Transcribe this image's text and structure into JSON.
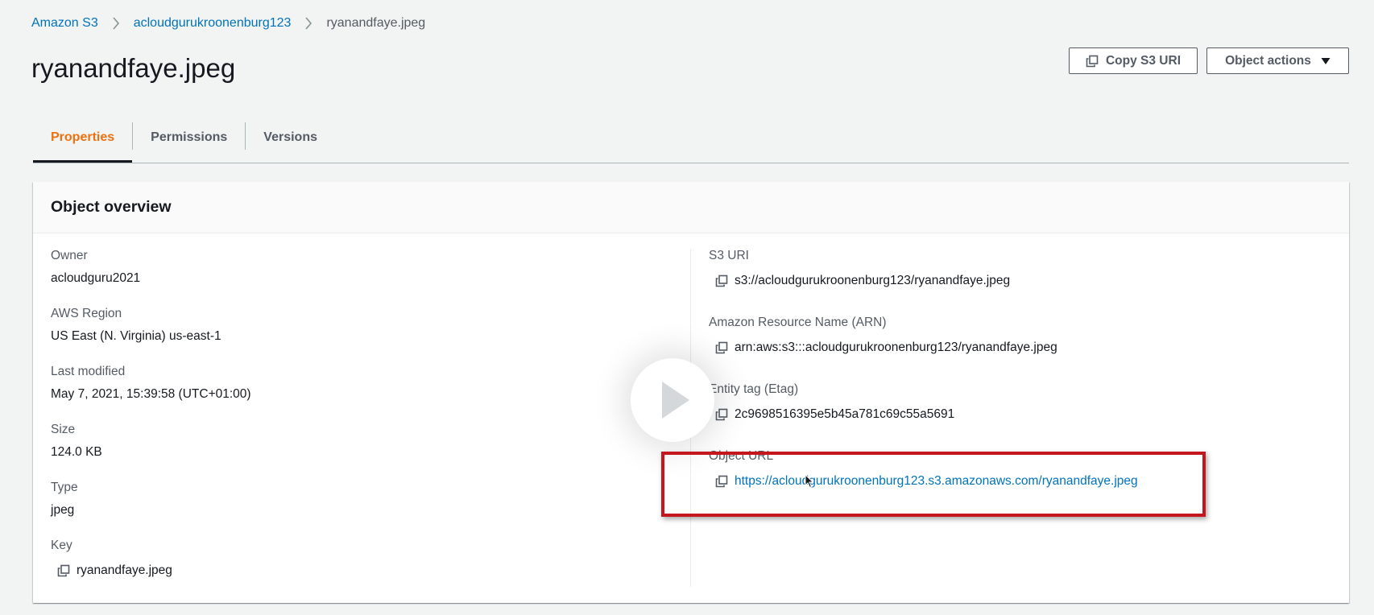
{
  "breadcrumb": {
    "items": [
      "Amazon S3",
      "acloudgurukroonenburg123"
    ],
    "current": "ryanandfaye.jpeg"
  },
  "page": {
    "title": "ryanandfaye.jpeg"
  },
  "header_actions": {
    "copy_uri": "Copy S3 URI",
    "object_actions": "Object actions"
  },
  "tabs": [
    {
      "label": "Properties",
      "active": true
    },
    {
      "label": "Permissions",
      "active": false
    },
    {
      "label": "Versions",
      "active": false
    }
  ],
  "overview": {
    "title": "Object overview",
    "left": {
      "owner": {
        "label": "Owner",
        "value": "acloudguru2021"
      },
      "region": {
        "label": "AWS Region",
        "value": "US East (N. Virginia) us-east-1"
      },
      "modified": {
        "label": "Last modified",
        "value": "May 7, 2021, 15:39:58 (UTC+01:00)"
      },
      "size": {
        "label": "Size",
        "value": "124.0 KB"
      },
      "type": {
        "label": "Type",
        "value": "jpeg"
      },
      "key": {
        "label": "Key",
        "value": "ryanandfaye.jpeg"
      }
    },
    "right": {
      "s3_uri": {
        "label": "S3 URI",
        "value": "s3://acloudgurukroonenburg123/ryanandfaye.jpeg"
      },
      "arn": {
        "label": "Amazon Resource Name (ARN)",
        "value": "arn:aws:s3:::acloudgurukroonenburg123/ryanandfaye.jpeg"
      },
      "etag": {
        "label": "Entity tag (Etag)",
        "value": "2c9698516395e5b45a781c69c55a5691"
      },
      "url": {
        "label": "Object URL",
        "value": "https://acloudgurukroonenburg123.s3.amazonaws.com/ryanandfaye.jpeg"
      }
    }
  },
  "colors": {
    "link": "#0073bb",
    "active_tab": "#ec7211",
    "highlight": "#c4161c",
    "background": "#f2f3f3"
  },
  "icons": {
    "copy": "copy-icon",
    "breadcrumb_separator": "chevron-right-icon",
    "dropdown": "caret-down-icon",
    "overlay": "play-icon",
    "cursor": "mouse-pointer-icon"
  }
}
